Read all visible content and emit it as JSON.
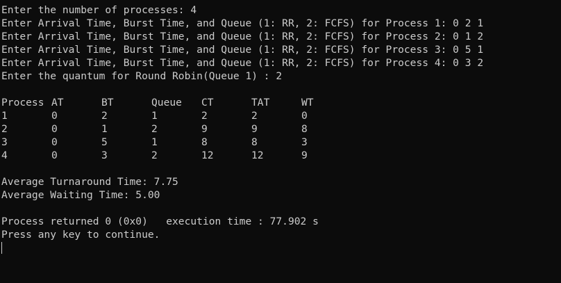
{
  "input_lines": [
    "Enter the number of processes: 4",
    "Enter Arrival Time, Burst Time, and Queue (1: RR, 2: FCFS) for Process 1: 0 2 1",
    "Enter Arrival Time, Burst Time, and Queue (1: RR, 2: FCFS) for Process 2: 0 1 2",
    "Enter Arrival Time, Burst Time, and Queue (1: RR, 2: FCFS) for Process 3: 0 5 1",
    "Enter Arrival Time, Burst Time, and Queue (1: RR, 2: FCFS) for Process 4: 0 3 2",
    "Enter the quantum for Round Robin(Queue 1) : 2"
  ],
  "table": {
    "headers": [
      "Process",
      "AT",
      "BT",
      "Queue",
      "CT",
      "TAT",
      "WT"
    ],
    "rows": [
      [
        "1",
        "0",
        "2",
        "1",
        "2",
        "2",
        "0"
      ],
      [
        "2",
        "0",
        "1",
        "2",
        "9",
        "9",
        "8"
      ],
      [
        "3",
        "0",
        "5",
        "1",
        "8",
        "8",
        "3"
      ],
      [
        "4",
        "0",
        "3",
        "2",
        "12",
        "12",
        "9"
      ]
    ]
  },
  "averages": {
    "turnaround": "Average Turnaround Time: 7.75",
    "waiting": "Average Waiting Time: 5.00"
  },
  "footer": {
    "returned": "Process returned 0 (0x0)   execution time : 77.902 s",
    "continue": "Press any key to continue."
  },
  "colors": {
    "background": "#0c0c0c",
    "text": "#cccccc"
  }
}
